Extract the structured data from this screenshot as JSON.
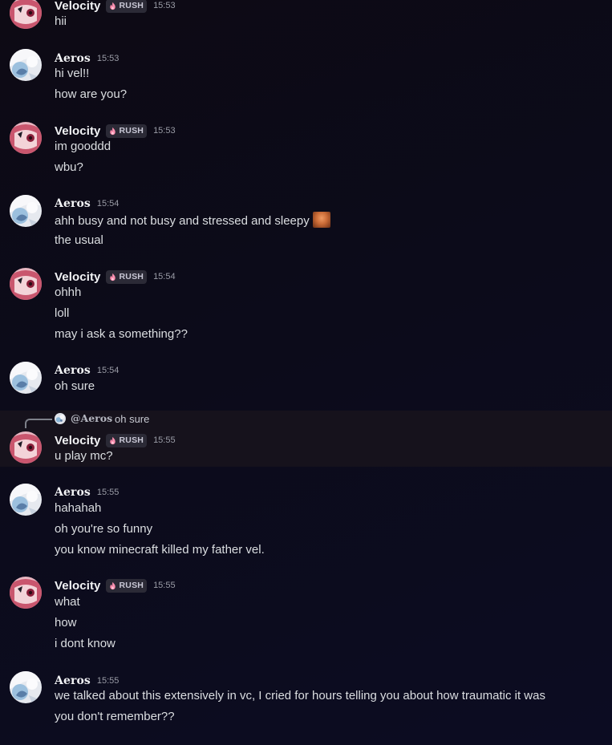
{
  "channel": {
    "messages": [
      {
        "author": "Velocity",
        "tag": "RUSH",
        "time": "15:53",
        "lines": [
          "hii"
        ]
      },
      {
        "author": "Aeros",
        "tag": "",
        "time": "15:53",
        "lines": [
          "hi vel!!",
          "how are you?"
        ]
      },
      {
        "author": "Velocity",
        "tag": "RUSH",
        "time": "15:53",
        "lines": [
          "im gooddd",
          "wbu?"
        ]
      },
      {
        "author": "Aeros",
        "tag": "",
        "time": "15:54",
        "lines": [
          "ahh busy and not busy and stressed and sleepy",
          "the usual"
        ]
      },
      {
        "author": "Velocity",
        "tag": "RUSH",
        "time": "15:54",
        "lines": [
          "ohhh",
          "loll",
          "may i ask a something??"
        ]
      },
      {
        "author": "Aeros",
        "tag": "",
        "time": "15:54",
        "lines": [
          "oh sure"
        ]
      },
      {
        "author": "Velocity",
        "tag": "RUSH",
        "time": "15:55",
        "lines": [
          "u play mc?"
        ]
      },
      {
        "author": "Aeros",
        "tag": "",
        "time": "15:55",
        "lines": [
          "hahahah",
          "oh you're so funny",
          "you know minecraft killed my father vel."
        ]
      },
      {
        "author": "Velocity",
        "tag": "RUSH",
        "time": "15:55",
        "lines": [
          "what",
          "how",
          "i dont know"
        ]
      },
      {
        "author": "Aeros",
        "tag": "",
        "time": "15:55",
        "lines": [
          "we talked about this extensively in vc, I cried for hours telling you about how traumatic it was",
          "you don't remember??"
        ]
      }
    ],
    "reply": {
      "mention": "@Aeros",
      "text": "oh sure"
    }
  },
  "icons": {
    "tag_icon": "flame-icon",
    "emoji": "face-emoji",
    "reply_connector": "reply-connector-icon"
  },
  "colors": {
    "velocity_avatar": "#d36f8a",
    "aeros_avatar": "#d9dde6",
    "tag_flame": "#ff8fb0"
  }
}
